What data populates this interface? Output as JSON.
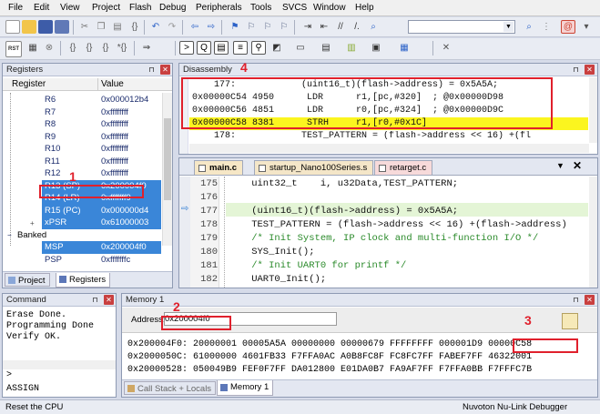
{
  "menu": [
    "File",
    "Edit",
    "View",
    "Project",
    "Flash",
    "Debug",
    "Peripherals",
    "Tools",
    "SVCS",
    "Window",
    "Help"
  ],
  "toolbar1_icons": [
    "new-file-icon",
    "open-icon",
    "save-icon",
    "save-all-icon",
    "cut-icon",
    "copy-icon",
    "paste-icon",
    "undo-icon",
    "redo-icon",
    "back-icon",
    "forward-icon",
    "bookmark-icon",
    "bookmark-prev-icon",
    "bookmark-next-icon",
    "bookmark-clear-icon",
    "indent-icon",
    "unindent-icon",
    "comment-icon",
    "uncomment-icon",
    "find-icon",
    "debug-icon"
  ],
  "toolbar2": {
    "rst_label": "RST"
  },
  "registers_panel": {
    "title": "Registers",
    "col_register": "Register",
    "col_value": "Value",
    "rows": [
      {
        "name": "R6",
        "value": "0x000012b4"
      },
      {
        "name": "R7",
        "value": "0xffffffff"
      },
      {
        "name": "R8",
        "value": "0xffffffff"
      },
      {
        "name": "R9",
        "value": "0xffffffff"
      },
      {
        "name": "R10",
        "value": "0xffffffff"
      },
      {
        "name": "R11",
        "value": "0xffffffff"
      },
      {
        "name": "R12",
        "value": "0xffffffff"
      },
      {
        "name": "R13 (SP)",
        "value": "0x200004f0"
      },
      {
        "name": "R14 (LR)",
        "value": "0xfffffff9"
      },
      {
        "name": "R15 (PC)",
        "value": "0x000000d4"
      },
      {
        "name": "xPSR",
        "value": "0x61000003"
      }
    ],
    "banked_label": "Banked",
    "banked_rows": [
      {
        "name": "MSP",
        "value": "0x200004f0"
      },
      {
        "name": "PSP",
        "value": "0xfffffffc"
      }
    ],
    "tab_project": "Project",
    "tab_registers": "Registers"
  },
  "disassembly": {
    "title": "Disassembly",
    "lines": [
      "    177:            (uint16_t)(flash->address) = 0x5A5A;",
      "0x00000C54 4950      LDR      r1,[pc,#320]  ; @0x00000D98",
      "0x00000C56 4851      LDR      r0,[pc,#324]  ; @0x00000D9C",
      "0x00000C58 8381      STRH     r1,[r0,#0x1C]",
      "    178:            TEST_PATTERN = (flash->address << 16) +(fl"
    ]
  },
  "editor": {
    "tabs": [
      "main.c",
      "startup_Nano100Series.s",
      "retarget.c"
    ],
    "lines": [
      {
        "num": "175",
        "code": "    uint32_t    i, u32Data,TEST_PATTERN;"
      },
      {
        "num": "176",
        "code": ""
      },
      {
        "num": "177",
        "code": "    (uint16_t)(flash->address) = 0x5A5A;"
      },
      {
        "num": "178",
        "code": "    TEST_PATTERN = (flash->address << 16) +(flash->address)"
      },
      {
        "num": "179",
        "code": "    /* Init System, IP clock and multi-function I/O */"
      },
      {
        "num": "180",
        "code": "    SYS_Init();"
      },
      {
        "num": "181",
        "code": "    /* Init UART0 for printf */"
      },
      {
        "num": "182",
        "code": "    UART0_Init();"
      }
    ]
  },
  "command": {
    "title": "Command",
    "lines": [
      "Erase Done.",
      "Programming Done",
      "Verify OK."
    ],
    "prompt": ">",
    "assign": "ASSIGN"
  },
  "memory": {
    "title": "Memory 1",
    "address_label": "Address:",
    "address_value": "0x200004f0",
    "lines": [
      "0x200004F0: 20000001 00005A5A 00000000 00000679 FFFFFFFF 000001D9 00000C58",
      "0x2000050C: 61000000 4601FB33 F7FFA0AC A0B8FC8F FC8FC7FF FABEF7FF 46322001",
      "0x20000528: 050049B9 FEF0F7FF DA012800 E01DA0B7 FA9AF7FF F7FFA0BB F7FFFC7B"
    ],
    "tab_callstack": "Call Stack + Locals",
    "tab_memory": "Memory 1"
  },
  "annotations": [
    "1",
    "2",
    "3",
    "4"
  ],
  "status": {
    "left": "Reset the CPU",
    "right": "Nuvoton Nu-Link Debugger"
  }
}
